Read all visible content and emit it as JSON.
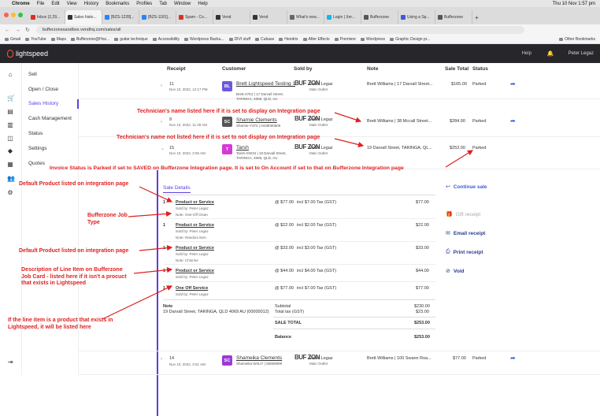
{
  "macbar": {
    "apple": "",
    "app": "Chrome",
    "menus": [
      "File",
      "Edit",
      "View",
      "History",
      "Bookmarks",
      "Profiles",
      "Tab",
      "Window",
      "Help"
    ],
    "clock": "Thu 10 Nov 1:57 pm"
  },
  "tabs": [
    "Inbox (2,29...",
    "Sales histo...",
    "[BZS-1228]...",
    "[BZS-1181]...",
    "Spam - Co...",
    "Vend",
    "Vend",
    "What's new...",
    "Login | Xer...",
    "Bufferzone",
    "Using a Sp...",
    "Bufferzone"
  ],
  "address": {
    "url": "bufferzonesandbox.vendhq.com/sales/all"
  },
  "bookmarks": [
    "Gmail",
    "YouTube",
    "Maps",
    "Bufferzone@Hoz...",
    "guitar technique",
    "Accessibility",
    "Wordpress Backu...",
    "DIVI stuff",
    "Cubase",
    "Hendrix",
    "After Effects",
    "Premiere",
    "Wordpress",
    "Graphic Design pr...",
    "Other Bookmarks"
  ],
  "topnav": {
    "brand": "lightspeed",
    "help": "Help",
    "user": "Peter Legaz"
  },
  "sidenav": {
    "items": [
      "Sell",
      "Open / Close",
      "Sales History",
      "Cash Management",
      "Status",
      "Settings",
      "Quotes"
    ]
  },
  "table": {
    "headers": [
      "Receipt",
      "Customer",
      "Sold by",
      "Note",
      "Sale Total",
      "Status"
    ],
    "rows": [
      {
        "receipt": "11",
        "date": "Nov 10, 2022, 12:17 PM",
        "initials": "BL",
        "color": "#6e57e0",
        "name": "Brett Lightspeed Testing 1",
        "sub": "Brett-47K2 | 17 Darvall Street, TARINGA, 4068, QLD, AU",
        "logo": "BUF ZON",
        "seller": "Peter Legaz",
        "outlet": "Main Outlet",
        "note": "Brett Williams | 17 Darvall Street...",
        "total": "$165.00",
        "status": "Parked"
      },
      {
        "receipt": "9",
        "date": "Nov 10, 2022, 11:28 AM",
        "initials": "SC",
        "color": "#555555",
        "name": "Sharnie Clements",
        "sub": "Sharnie-Y374 | 0448000606",
        "logo": "BUF ZON",
        "seller": "Peter Legaz",
        "outlet": "Main Outlet",
        "note": "Brett Williams | 38 Mccall Street...",
        "total": "$284.90",
        "status": "Parked"
      },
      {
        "receipt": "15",
        "date": "Nov 10, 2022, 2:56 AM",
        "initials": "T",
        "color": "#d63ad6",
        "name": "Tarsh",
        "sub": "Tarsh-GW34 | 19 Darvall Street, TARINGA, 4069, QLD, AU",
        "logo": "BUF ZON",
        "seller": "Peter Legaz",
        "outlet": "Main Outlet",
        "note": "19 Darvall Street, TARINGA, QL...",
        "total": "$253.00",
        "status": "Parked"
      },
      {
        "receipt": "14",
        "date": "Nov 10, 2022, 2:51 AM",
        "initials": "SC",
        "color": "#9b3ad6",
        "name": "Shameika Clements",
        "sub": "Shameika-W4UY | 55559999",
        "logo": "BUF ZON",
        "seller": "Peter Legaz",
        "outlet": "Main Outlet",
        "note": "Brett Williams | 100 Swann Roa...",
        "total": "$77.00",
        "status": "Parked"
      }
    ]
  },
  "detail": {
    "tab": "Sale Details",
    "lines": [
      {
        "qty": "1",
        "product": "Product or Service",
        "sold": "Sold by: Peter Legaz",
        "note": "Note: One-Off Clean",
        "price": "@ $77.00",
        "tax": "incl $7.00 Tax (GST)",
        "total": "$77.00"
      },
      {
        "qty": "1",
        "product": "Product or Service",
        "sold": "Sold by: Peter Legaz",
        "note": "Note: Random item",
        "price": "@ $22.00",
        "tax": "incl $2.00 Tax (GST)",
        "total": "$22.00"
      },
      {
        "qty": "1",
        "product": "Product or Service",
        "sold": "Sold by: Peter Legaz",
        "note": "Note: Chlorine",
        "price": "@ $33.00",
        "tax": "incl $3.00 Tax (GST)",
        "total": "$33.00"
      },
      {
        "qty": "1",
        "product": "Product or Service",
        "sold": "Sold by: Peter Legaz",
        "note": "",
        "price": "@ $44.00",
        "tax": "incl $4.00 Tax (GST)",
        "total": "$44.00"
      },
      {
        "qty": "1",
        "product": "One Off Service",
        "sold": "Sold by: Peter Legaz",
        "note": "",
        "price": "@ $77.00",
        "tax": "incl $7.00 Tax (GST)",
        "total": "$77.00"
      }
    ],
    "note_label": "Note",
    "note_text": "19 Darvall Street, TARINGA, QLD 4069 AU (00000012)",
    "subtotal_label": "Subtotal",
    "subtotal": "$230.00",
    "tax_label": "Total tax (GST)",
    "tax": "$23.00",
    "sale_total_label": "SALE TOTAL",
    "sale_total": "$253.00",
    "balance_label": "Balance",
    "balance": "$253.00",
    "actions": {
      "continue": "Continue sale",
      "gift": "Gift receipt",
      "email": "Email receipt",
      "print": "Print receipt",
      "void": "Void"
    }
  },
  "annotations": [
    "Technician's name listed here if it is set to display on Integration page",
    "Technician's name not listed here if it is set to not display on Integration page",
    "Invoice Status is Parked if set to SAVED on Bufferzone Integration page. It is set to On Account if set to that on Bufferzone Integration page",
    "Default Product listed on integration page",
    "Bufferzone Job\nType",
    "Default Product listed on integration page",
    "Description of Line Item on Bufferzone\nJob Card - listed here if it isn't a procuct\nthat exists in Lightspeed",
    "If the line item is a product that exists in\nLightspeed, it will be listed here"
  ],
  "colors": {
    "accent": "#5f3de0",
    "annotation": "#e02020",
    "nav": "#26262b",
    "link": "#3b5bdb"
  }
}
